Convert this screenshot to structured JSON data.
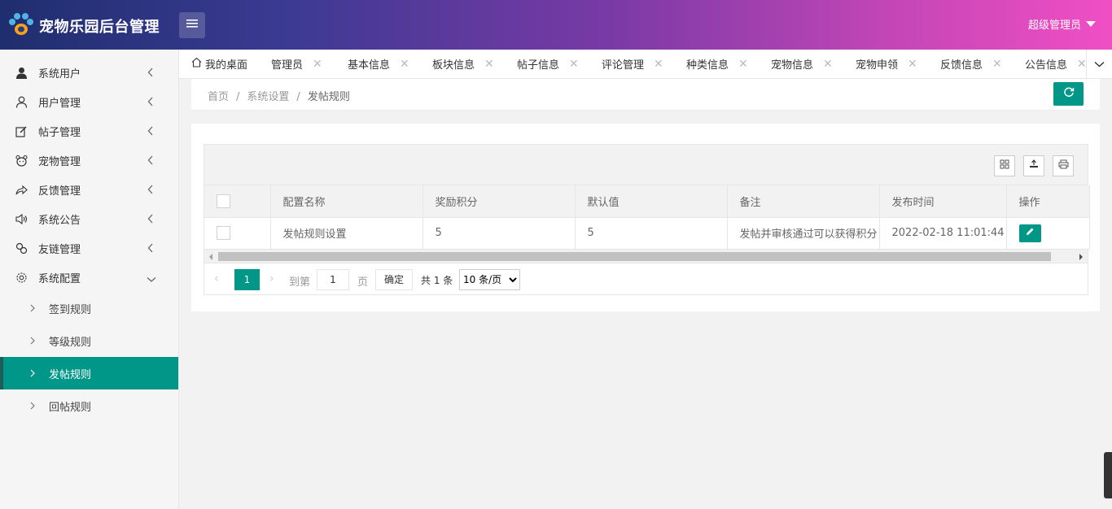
{
  "header": {
    "title": "宠物乐园后台管理",
    "user": "超级管理员",
    "logo_icon": "paw-icon",
    "menu_icon": "hamburger-icon"
  },
  "sidebar": {
    "items": [
      {
        "label": "系统用户",
        "icon": "user-solid-icon"
      },
      {
        "label": "用户管理",
        "icon": "user-outline-icon"
      },
      {
        "label": "帖子管理",
        "icon": "edit-icon"
      },
      {
        "label": "宠物管理",
        "icon": "bear-icon"
      },
      {
        "label": "反馈管理",
        "icon": "share-icon"
      },
      {
        "label": "系统公告",
        "icon": "speaker-icon"
      },
      {
        "label": "友链管理",
        "icon": "link-icon"
      },
      {
        "label": "系统配置",
        "icon": "gear-icon"
      }
    ],
    "subitems": [
      {
        "label": "签到规则"
      },
      {
        "label": "等级规则"
      },
      {
        "label": "发帖规则"
      },
      {
        "label": "回帖规则"
      }
    ]
  },
  "tabs": [
    {
      "label": "我的桌面"
    },
    {
      "label": "管理员"
    },
    {
      "label": "基本信息"
    },
    {
      "label": "板块信息"
    },
    {
      "label": "帖子信息"
    },
    {
      "label": "评论管理"
    },
    {
      "label": "种类信息"
    },
    {
      "label": "宠物信息"
    },
    {
      "label": "宠物申领"
    },
    {
      "label": "反馈信息"
    },
    {
      "label": "公告信息"
    }
  ],
  "breadcrumb": {
    "home": "首页",
    "parent": "系统设置",
    "current": "发帖规则"
  },
  "table": {
    "columns": [
      "配置名称",
      "奖励积分",
      "默认值",
      "备注",
      "发布时间",
      "操作"
    ],
    "rows": [
      {
        "name": "发帖规则设置",
        "reward": "5",
        "default": "5",
        "remark": "发帖并审核通过可以获得积分",
        "time": "2022-02-18 11:01:44"
      }
    ]
  },
  "pagination": {
    "current": "1",
    "goto_label": "到第",
    "page_input": "1",
    "page_unit": "页",
    "confirm": "确定",
    "total": "共 1 条",
    "page_size": "10 条/页"
  },
  "colors": {
    "accent": "#009688",
    "header_start": "#1f2e6e",
    "header_end": "#f04fc4"
  }
}
